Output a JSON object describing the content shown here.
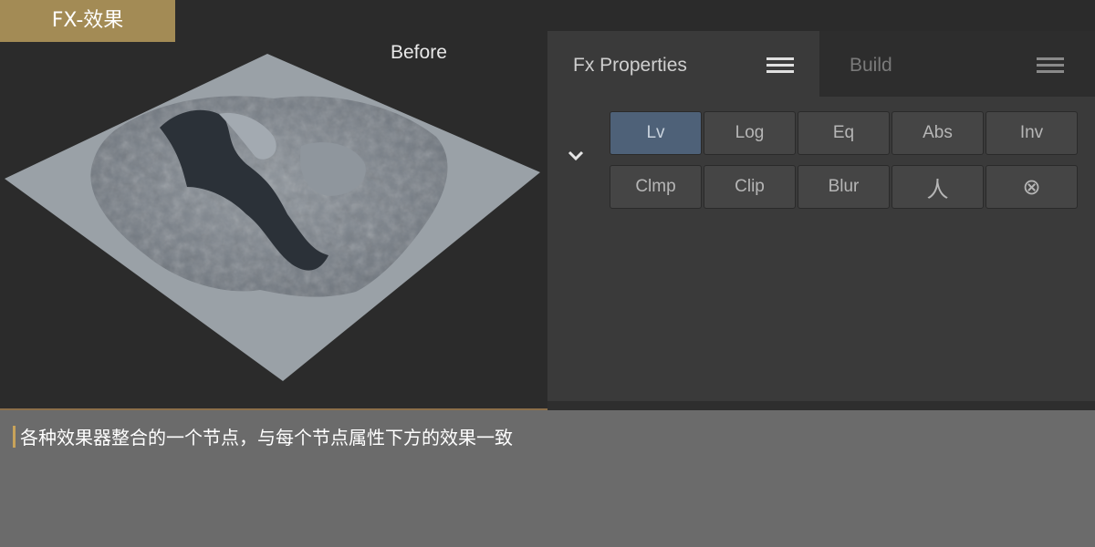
{
  "title_tag": "FX-效果",
  "viewport": {
    "label": "Before"
  },
  "panel": {
    "tabs": [
      {
        "label": "Fx Properties",
        "active": true
      },
      {
        "label": "Build",
        "active": false
      }
    ],
    "buttons_row1": [
      "Lv",
      "Log",
      "Eq",
      "Abs",
      "Inv"
    ],
    "buttons_row2": [
      "Clmp",
      "Clip",
      "Blur",
      "人",
      "⊗"
    ],
    "active_button": "Lv"
  },
  "caption": "各种效果器整合的一个节点，与每个节点属性下方的效果一致",
  "colors": {
    "accent": "#a38b55",
    "active_button": "#4e6178",
    "caption_marker": "#c8a35a"
  }
}
